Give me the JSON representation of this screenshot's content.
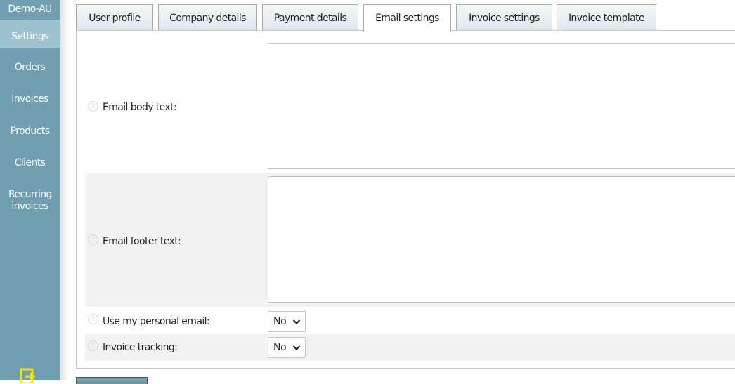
{
  "sidebar": {
    "account_name": "Demo-AU",
    "items": [
      {
        "label": "Settings",
        "active": true
      },
      {
        "label": "Orders",
        "active": false
      },
      {
        "label": "Invoices",
        "active": false
      },
      {
        "label": "Products",
        "active": false
      },
      {
        "label": "Clients",
        "active": false
      },
      {
        "label": "Recurring invoices",
        "active": false
      }
    ],
    "logout_icon": "logout-icon"
  },
  "tabs": [
    {
      "label": "User profile",
      "active": false
    },
    {
      "label": "Company details",
      "active": false
    },
    {
      "label": "Payment details",
      "active": false
    },
    {
      "label": "Email settings",
      "active": true
    },
    {
      "label": "Invoice settings",
      "active": false
    },
    {
      "label": "Invoice template",
      "active": false
    }
  ],
  "form": {
    "email_body": {
      "label": "Email body text:",
      "value": ""
    },
    "email_footer": {
      "label": "Email footer text:",
      "value": ""
    },
    "personal_email": {
      "label": "Use my personal email:",
      "value": "No"
    },
    "invoice_tracking": {
      "label": "Invoice tracking:",
      "value": "No"
    }
  },
  "icons": {
    "help": "help-icon",
    "dropdown": "chevron-down-icon"
  },
  "colors": {
    "sidebar": "#6f9fb0",
    "sidebar_active": "#9dc3d1",
    "logout_icon": "#f5e400",
    "alt_row": "#f2f2f2"
  }
}
